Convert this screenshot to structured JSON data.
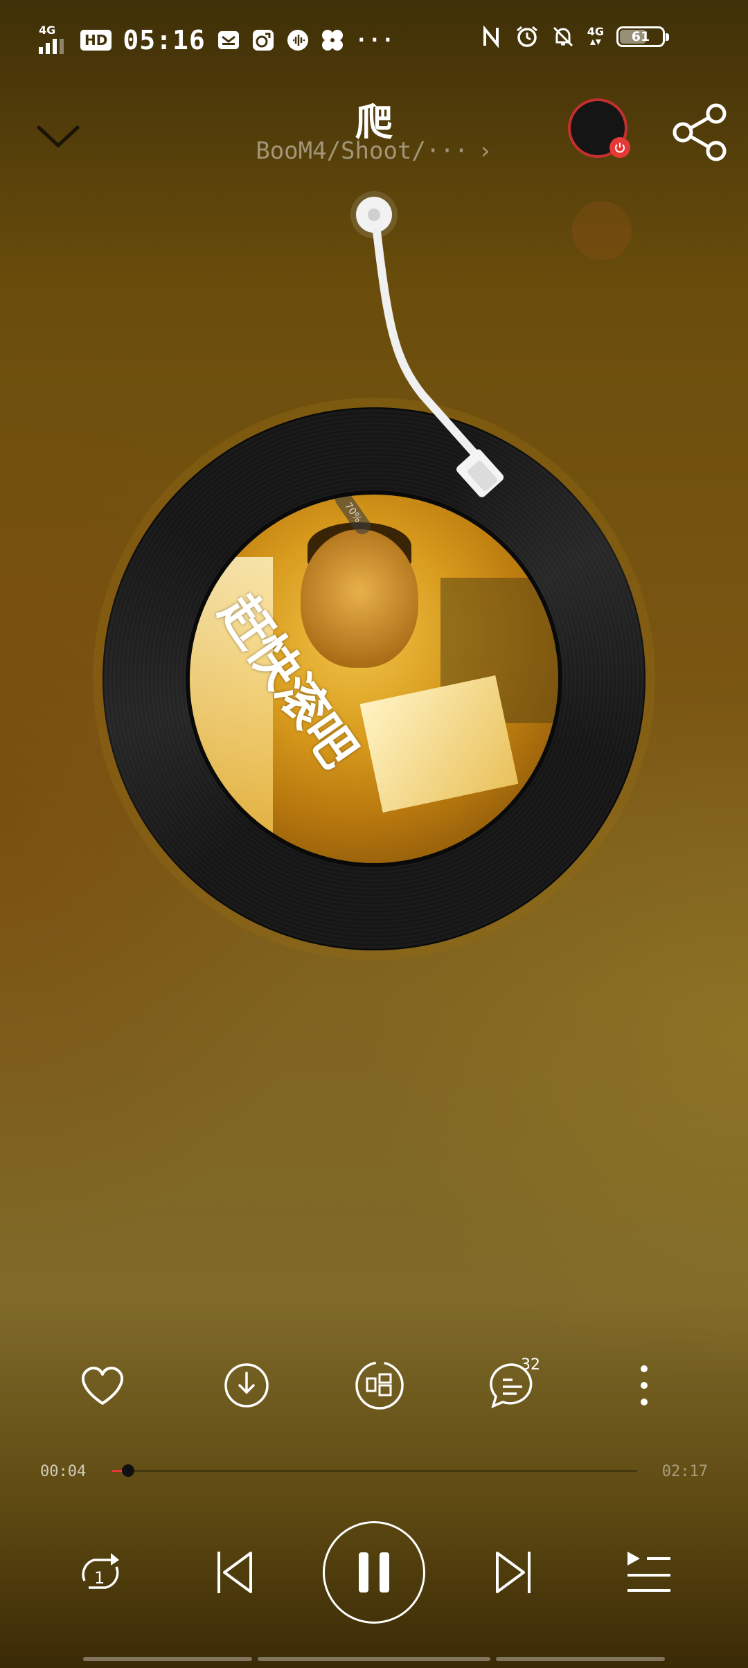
{
  "status_bar": {
    "network_left": "4G",
    "hd_label": "HD",
    "time": "05:16",
    "network_right": "4G",
    "battery": "61",
    "more": "···",
    "icons": [
      "signal-icon",
      "hd-icon",
      "mail-icon",
      "app-icon",
      "music-icon",
      "fan-icon",
      "nfc-icon",
      "alarm-icon",
      "mute-icon",
      "battery-icon"
    ]
  },
  "header": {
    "title": "爬",
    "subtitle": "BooM4/Shoot/···",
    "subtitle_chevron": "›"
  },
  "cover": {
    "caption": "赶快滚吧",
    "pill": "70%"
  },
  "actions": {
    "comment_count": "32",
    "icons": [
      "heart-icon",
      "download-icon",
      "sing-icon",
      "comment-icon",
      "more-icon"
    ]
  },
  "progress": {
    "current": "00:04",
    "total": "02:17",
    "fraction": 0.03
  },
  "controls": {
    "repeat_badge": "1",
    "icons": [
      "repeat-one-icon",
      "previous-icon",
      "pause-icon",
      "next-icon",
      "playlist-icon"
    ]
  },
  "colors": {
    "accent": "#e53935",
    "avatar_ring": "#c23030"
  }
}
